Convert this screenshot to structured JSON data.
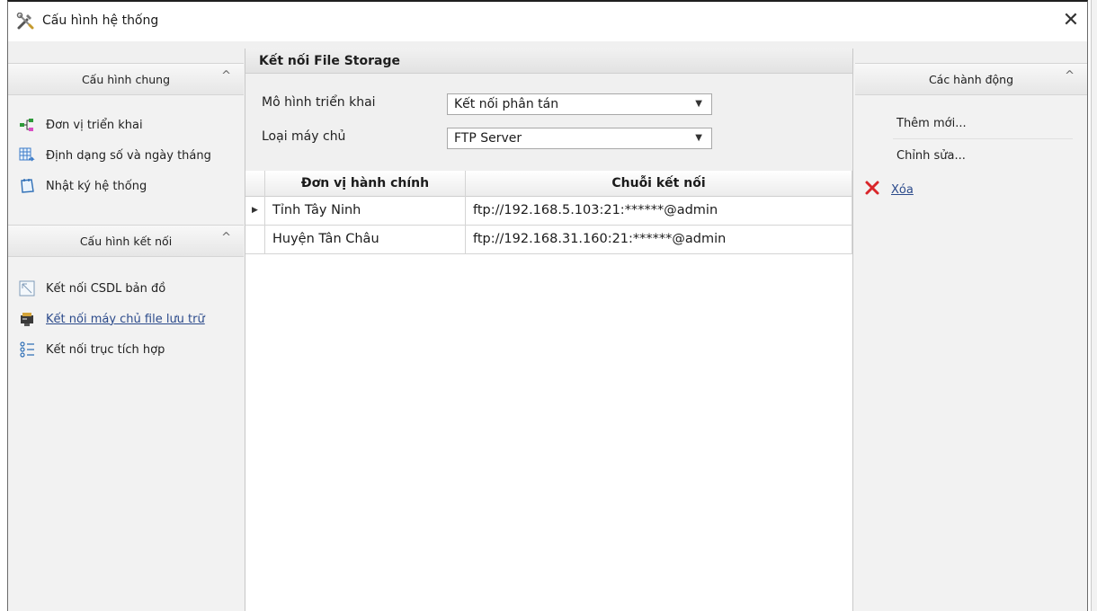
{
  "window": {
    "title": "Cấu hình hệ thống",
    "close_glyph": "✕"
  },
  "left_panel": {
    "general_group": {
      "title": "Cấu hình chung",
      "items": [
        {
          "label": "Đơn vị triển khai",
          "icon": "hierarchy-icon"
        },
        {
          "label": "Định dạng số và ngày tháng",
          "icon": "format-table-icon"
        },
        {
          "label": "Nhật ký hệ thống",
          "icon": "log-icon"
        }
      ]
    },
    "connection_group": {
      "title": "Cấu hình kết nối",
      "items": [
        {
          "label": "Kết nối CSDL bản đồ",
          "icon": "map-icon"
        },
        {
          "label": "Kết nối máy chủ file lưu trữ",
          "icon": "file-server-icon",
          "active": true
        },
        {
          "label": "Kết nối trục tích hợp",
          "icon": "list-icon"
        }
      ]
    }
  },
  "center_panel": {
    "title": "Kết nối File Storage",
    "deployment_model": {
      "label": "Mô hình triển khai",
      "value": "Kết nối phân tán"
    },
    "server_type": {
      "label": "Loại máy chủ",
      "value": "FTP Server"
    },
    "grid": {
      "columns": [
        "Đơn vị hành chính",
        "Chuỗi kết nối"
      ],
      "rows": [
        {
          "unit": "Tỉnh Tây Ninh",
          "connection": "ftp://192.168.5.103:21:******@admin",
          "current": true
        },
        {
          "unit": "Huyện Tân Châu",
          "connection": "ftp://192.168.31.160:21:******@admin",
          "current": false
        }
      ]
    }
  },
  "right_panel": {
    "title": "Các hành động",
    "actions": {
      "add": "Thêm mới...",
      "edit": "Chỉnh sửa...",
      "delete": "Xóa"
    }
  },
  "colors": {
    "link": "#2b4a8b",
    "delete_icon": "#d9262a"
  }
}
